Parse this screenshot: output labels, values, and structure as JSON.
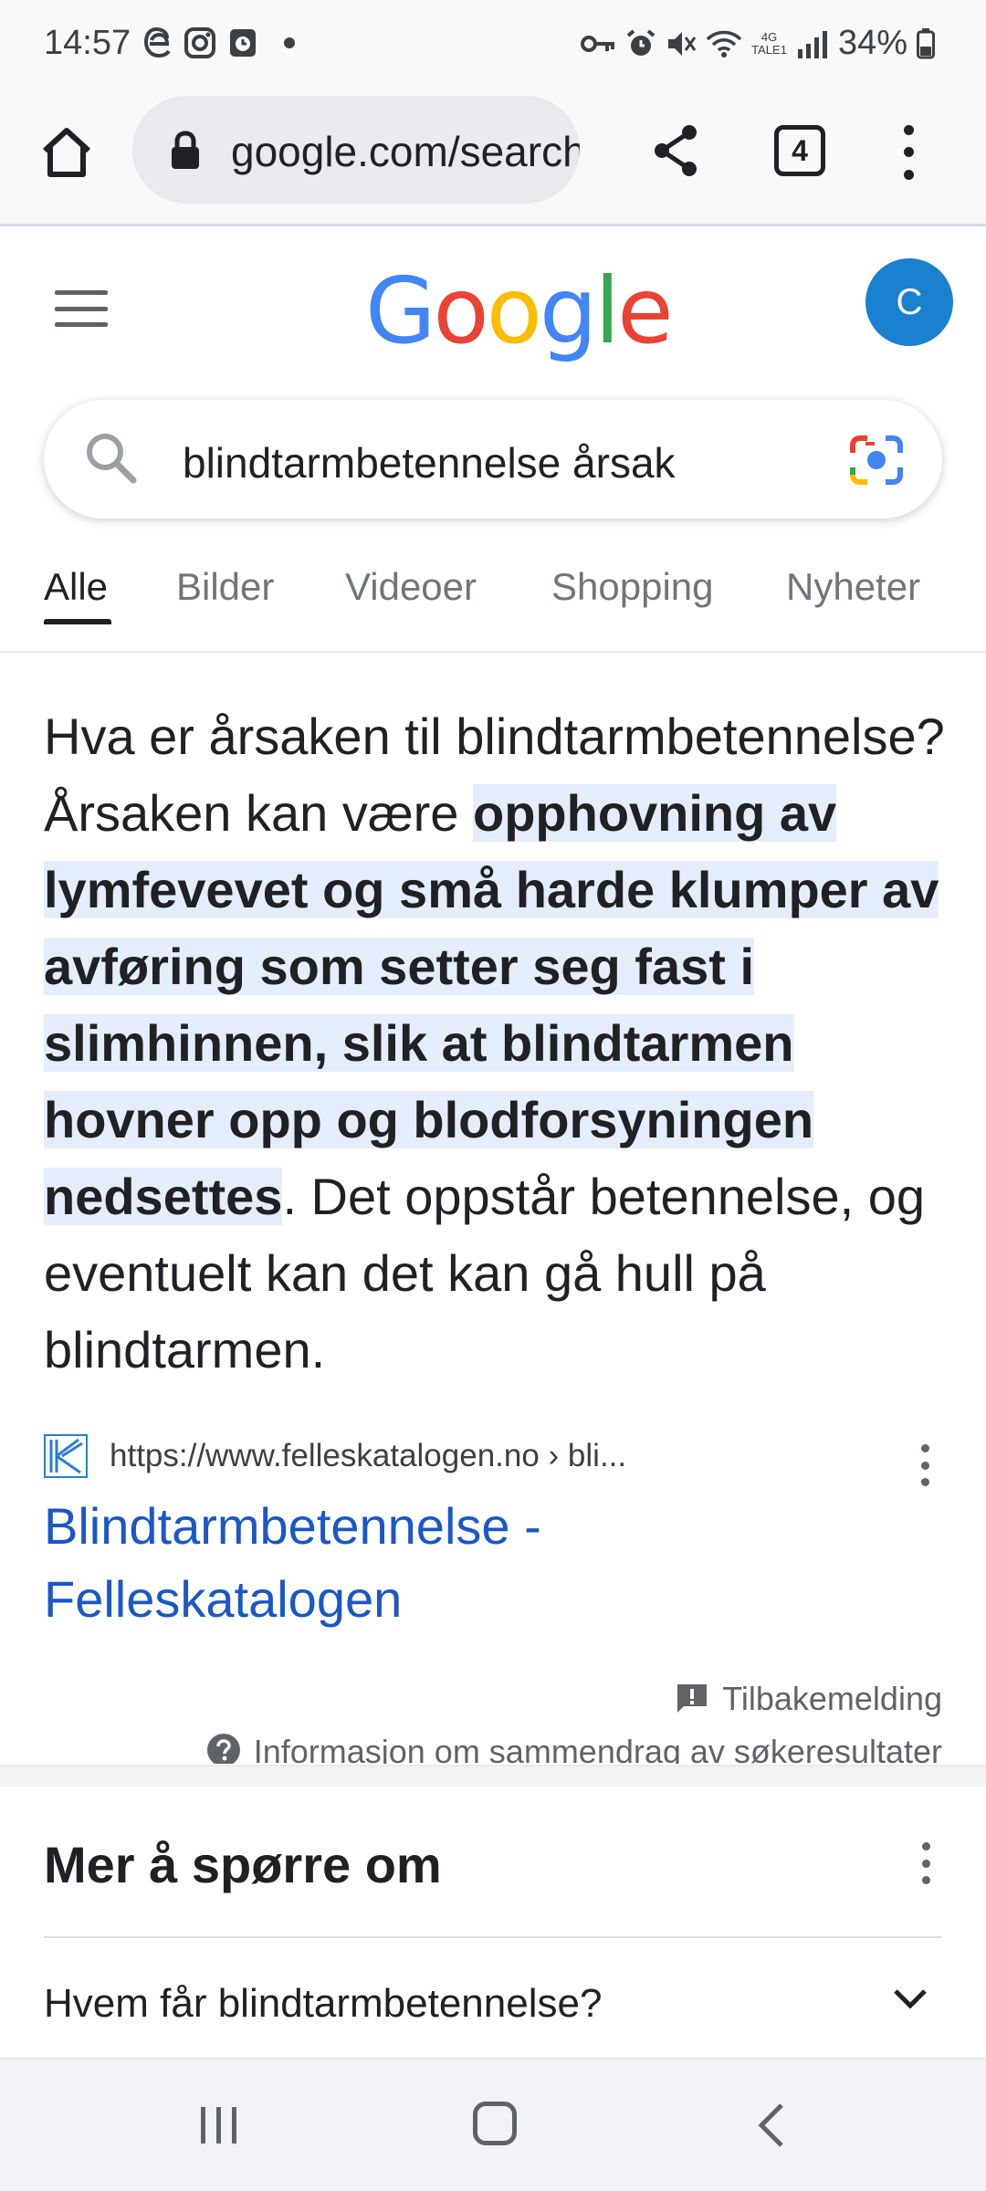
{
  "status_bar": {
    "time": "14:57",
    "left_icons": [
      "edge-icon",
      "instagram-icon",
      "clock-app-icon",
      "dot-icon"
    ],
    "right_icons": [
      "key-icon",
      "alarm-icon",
      "mute-icon",
      "wifi-icon",
      "4g-signal-icon",
      "battery-icon"
    ],
    "network_label_top": "4G",
    "network_label_bottom": "TALE1",
    "battery": "34%"
  },
  "browser": {
    "url": "google.com/search",
    "tab_count": "4"
  },
  "header": {
    "logo": "Google",
    "logo_colors": [
      "#4285F4",
      "#EA4335",
      "#FBBC05",
      "#4285F4",
      "#34A853",
      "#EA4335"
    ],
    "avatar_letter": "C",
    "avatar_color": "#1a80d0"
  },
  "search": {
    "query": "blindtarmbetennelse årsak"
  },
  "tabs": [
    {
      "label": "Alle",
      "active": true
    },
    {
      "label": "Bilder",
      "active": false
    },
    {
      "label": "Videoer",
      "active": false
    },
    {
      "label": "Shopping",
      "active": false
    },
    {
      "label": "Nyheter",
      "active": false
    }
  ],
  "snippet": {
    "text_before": "Hva er årsaken til blindtarmbetennelse? Årsaken kan være ",
    "highlight": "opphovning av lymfevevet og små harde klumper av avføring som setter seg fast i slimhinnen, slik at blindtarmen hovner opp og blodforsyningen nedsettes",
    "text_after": ". Det oppstår betennelse, og eventuelt kan det kan gå hull på blindtarmen.",
    "source_url": "https://www.felleskatalogen.no › bli...",
    "result_title": "Blindtarmbetennelse - Felleskatalogen",
    "feedback": "Tilbakemelding",
    "info": "Informasjon om sammendrag av søkeresultater"
  },
  "people_also_ask": {
    "title": "Mer å spørre om",
    "questions": [
      "Hvem får blindtarmbetennelse?"
    ]
  },
  "nav_bar": {
    "buttons": [
      "recent-apps",
      "home",
      "back"
    ]
  }
}
